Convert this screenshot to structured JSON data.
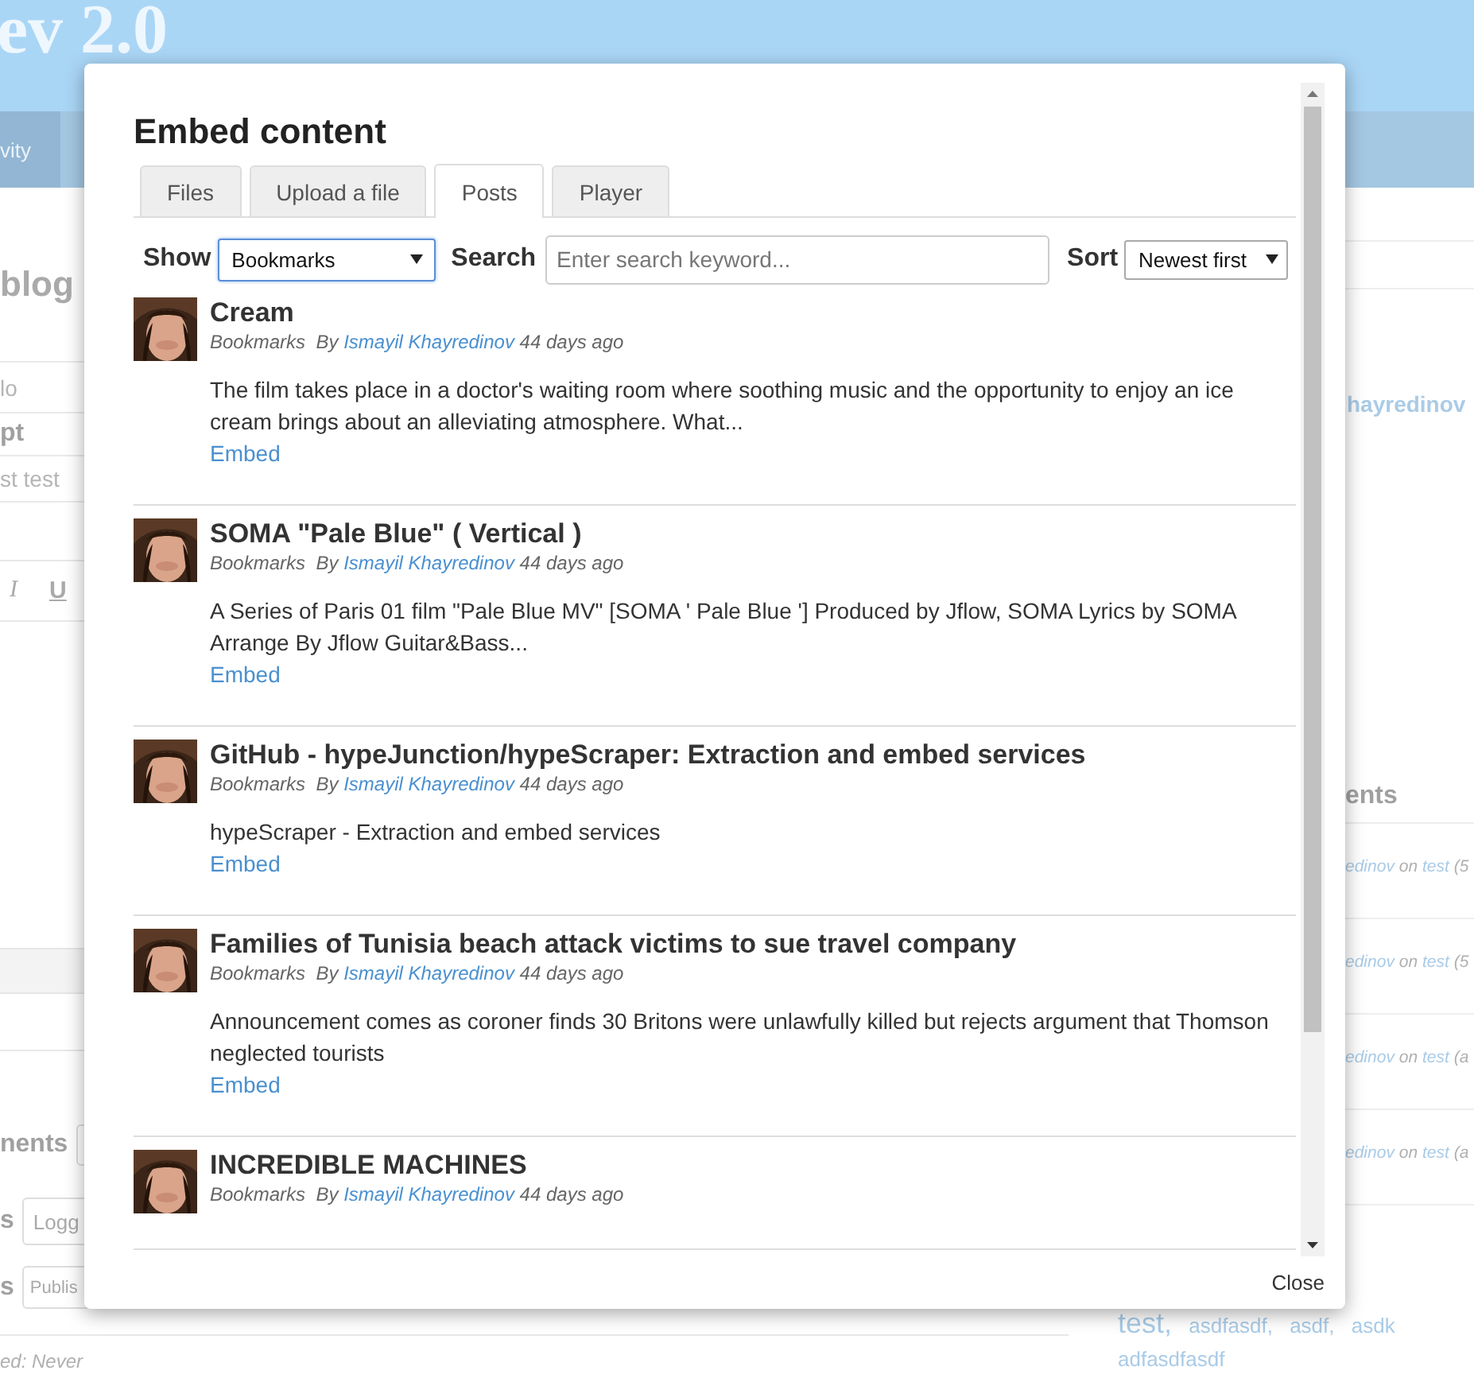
{
  "page": {
    "site_title": "ev 2.0",
    "nav": [
      {
        "label": "vity",
        "selected": true
      }
    ],
    "heading": "blog",
    "title_value": "lo",
    "excerpt_label": "pt",
    "excerpt_value": "st test",
    "format_buttons": [
      {
        "label": "I",
        "kind": "italic"
      },
      {
        "label": "U",
        "kind": "underline"
      }
    ],
    "comments_label": "nents",
    "access_label": "s",
    "access_value": "Logg",
    "status_label": "s",
    "status_value": "Publis",
    "footer_note": "ed: Never"
  },
  "sidebar": {
    "author": "hayredinov",
    "comments_heading": "ents",
    "comments": [
      {
        "author": "edinov",
        "on": "on",
        "post": "test",
        "tail": "(5"
      },
      {
        "author": "edinov",
        "on": "on",
        "post": "test",
        "tail": "(5"
      },
      {
        "author": "edinov",
        "on": "on",
        "post": "test",
        "tail": "(a"
      },
      {
        "author": "edinov",
        "on": "on",
        "post": "test",
        "tail": "(a"
      }
    ],
    "tags": [
      {
        "label": "test",
        "separator": ",",
        "kind": "large"
      },
      {
        "label": "asdfasdf",
        "separator": ",",
        "kind": "small"
      },
      {
        "label": "asdf",
        "separator": ",",
        "kind": "small"
      },
      {
        "label": "asdk",
        "kind": "small"
      },
      {
        "label": "adfasdfasdf",
        "kind": "small"
      }
    ]
  },
  "dialog": {
    "title": "Embed content",
    "tabs": [
      {
        "label": "Files",
        "selected": false
      },
      {
        "label": "Upload a file",
        "selected": false
      },
      {
        "label": "Posts",
        "selected": true
      },
      {
        "label": "Player",
        "selected": false
      }
    ],
    "show_label": "Show",
    "show_value": "Bookmarks",
    "search_label": "Search",
    "search_placeholder": "Enter search keyword...",
    "sort_label": "Sort",
    "sort_value": "Newest first",
    "posts": [
      {
        "title": "Cream",
        "category": "Bookmarks",
        "by": "By",
        "author": "Ismayil Khayredinov",
        "time": "44 days ago",
        "description": "The film takes place in a doctor's waiting room where soothing music and the opportunity to enjoy an ice cream brings about an alleviating atmosphere. What...",
        "action": "Embed"
      },
      {
        "title": "SOMA \"Pale Blue\" ( Vertical )",
        "category": "Bookmarks",
        "by": "By",
        "author": "Ismayil Khayredinov",
        "time": "44 days ago",
        "description": "A Series of Paris 01 film \"Pale Blue MV\" [SOMA ' Pale Blue '] Produced by Jflow, SOMA Lyrics by SOMA Arrange By Jflow Guitar&Bass...",
        "action": "Embed"
      },
      {
        "title": "GitHub - hypeJunction/hypeScraper: Extraction and embed services",
        "category": "Bookmarks",
        "by": "By",
        "author": "Ismayil Khayredinov",
        "time": "44 days ago",
        "description": "hypeScraper - Extraction and embed services",
        "action": "Embed"
      },
      {
        "title": "Families of Tunisia beach attack victims to sue travel company",
        "category": "Bookmarks",
        "by": "By",
        "author": "Ismayil Khayredinov",
        "time": "44 days ago",
        "description": "Announcement comes as coroner finds 30 Britons were unlawfully killed but rejects argument that Thomson neglected tourists",
        "action": "Embed"
      },
      {
        "title": "INCREDIBLE MACHINES",
        "category": "Bookmarks",
        "by": "By",
        "author": "Ismayil Khayredinov",
        "time": "44 days ago"
      }
    ],
    "close": "Close"
  }
}
